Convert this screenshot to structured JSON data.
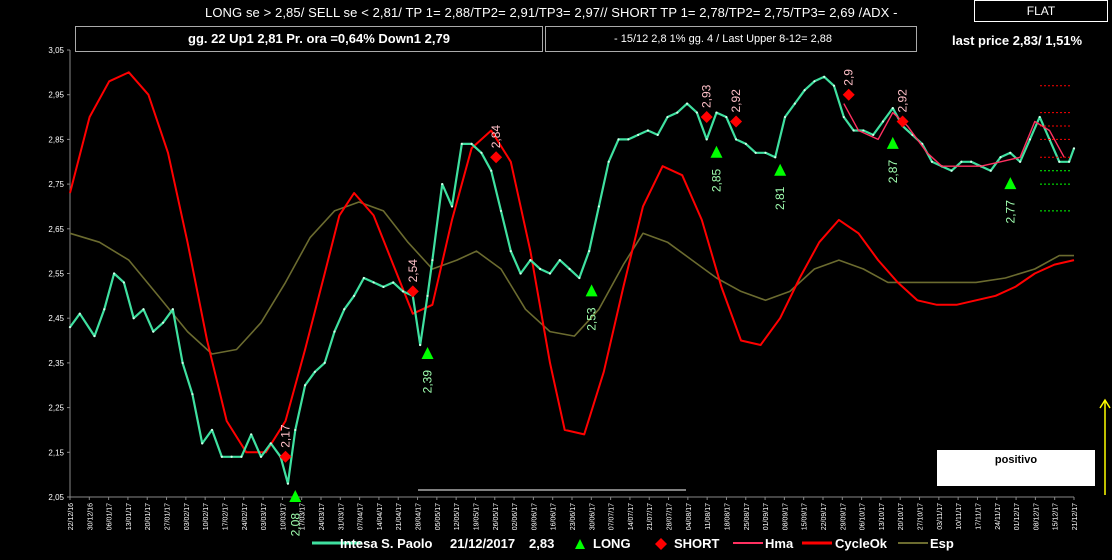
{
  "header": {
    "signal_line": "LONG se > 2,85/   SELL se < 2,81/  TP 1= 2,88/TP2= 2,91/TP3= 2,97//    SHORT  TP 1= 2,78/TP2= 2,75/TP3= 2,69 /ADX -",
    "flat_label": "FLAT",
    "box1_text": "gg. 22 Up1   2,81   Pr. ora =0,64%    Down1  2,79",
    "box2_text": "-  15/12   2,8   1%  gg. 4 / Last Upper 8-12= 2,88",
    "last_price_text": "last price 2,83/  1,51%",
    "positivo_label": "positivo"
  },
  "legend": {
    "series_name": "Intesa S. Paolo",
    "date": "21/12/2017",
    "price": "2,83",
    "long": "LONG",
    "short": "SHORT",
    "hma": "Hma",
    "cycle": "CycleOk",
    "esp": "Esp"
  },
  "colors": {
    "background": "#000000",
    "price_line": "#3fe0a0",
    "long_marker": "#00ff00",
    "short_marker": "#ff0000",
    "hma": "#ff3060",
    "cycle": "#ff0000",
    "esp": "#6b6b2f",
    "label_long": "#a0ffb0",
    "label_short": "#ffc0c8",
    "arrow": "#ffff00"
  },
  "chart_data": {
    "type": "line",
    "ylim": [
      2.05,
      3.05
    ],
    "y_ticks": [
      "3,05",
      "2,95",
      "2,85",
      "2,75",
      "2,65",
      "2,55",
      "2,45",
      "2,35",
      "2,25",
      "2,15",
      "2,05"
    ],
    "x_ticks": [
      "22/12/16",
      "30/12/16",
      "06/01/17",
      "13/01/17",
      "20/01/17",
      "27/01/17",
      "03/02/17",
      "10/02/17",
      "17/02/17",
      "24/02/17",
      "03/03/17",
      "10/03/17",
      "17/03/17",
      "24/03/17",
      "31/03/17",
      "07/04/17",
      "14/04/17",
      "21/04/17",
      "28/04/17",
      "05/05/17",
      "12/05/17",
      "19/05/17",
      "26/05/17",
      "02/06/17",
      "09/06/17",
      "16/06/17",
      "23/06/17",
      "30/06/17",
      "07/07/17",
      "14/07/17",
      "21/07/17",
      "28/07/17",
      "04/08/17",
      "11/08/17",
      "18/08/17",
      "25/08/17",
      "01/09/17",
      "08/09/17",
      "15/09/17",
      "22/09/17",
      "29/09/17",
      "06/10/17",
      "13/10/17",
      "20/10/17",
      "27/10/17",
      "03/11/17",
      "10/11/17",
      "17/11/17",
      "24/11/17",
      "01/12/17",
      "08/12/17",
      "15/12/17",
      "21/12/17"
    ],
    "n_points": 260,
    "series": [
      {
        "name": "Intesa S. Paolo",
        "points": [
          [
            0,
            2.43
          ],
          [
            4,
            2.46
          ],
          [
            10,
            2.41
          ],
          [
            14,
            2.47
          ],
          [
            18,
            2.55
          ],
          [
            22,
            2.53
          ],
          [
            26,
            2.45
          ],
          [
            30,
            2.47
          ],
          [
            34,
            2.42
          ],
          [
            38,
            2.44
          ],
          [
            42,
            2.47
          ],
          [
            46,
            2.35
          ],
          [
            50,
            2.28
          ],
          [
            54,
            2.17
          ],
          [
            58,
            2.2
          ],
          [
            62,
            2.14
          ],
          [
            66,
            2.14
          ],
          [
            70,
            2.14
          ],
          [
            74,
            2.19
          ],
          [
            78,
            2.14
          ],
          [
            82,
            2.17
          ],
          [
            86,
            2.14
          ],
          [
            89,
            2.08
          ],
          [
            92,
            2.2
          ],
          [
            96,
            2.3
          ],
          [
            100,
            2.33
          ],
          [
            104,
            2.35
          ],
          [
            108,
            2.42
          ],
          [
            112,
            2.47
          ],
          [
            116,
            2.5
          ],
          [
            120,
            2.54
          ],
          [
            124,
            2.53
          ],
          [
            128,
            2.52
          ],
          [
            132,
            2.53
          ],
          [
            136,
            2.51
          ],
          [
            140,
            2.5
          ],
          [
            143,
            2.39
          ],
          [
            146,
            2.5
          ],
          [
            148,
            2.58
          ],
          [
            152,
            2.75
          ],
          [
            156,
            2.7
          ],
          [
            160,
            2.84
          ],
          [
            164,
            2.84
          ],
          [
            168,
            2.82
          ],
          [
            172,
            2.78
          ],
          [
            176,
            2.69
          ],
          [
            180,
            2.6
          ],
          [
            184,
            2.55
          ],
          [
            188,
            2.58
          ],
          [
            192,
            2.56
          ],
          [
            196,
            2.55
          ],
          [
            200,
            2.58
          ],
          [
            204,
            2.56
          ],
          [
            208,
            2.54
          ],
          [
            212,
            2.6
          ],
          [
            216,
            2.7
          ],
          [
            220,
            2.8
          ],
          [
            224,
            2.85
          ],
          [
            228,
            2.85
          ],
          [
            232,
            2.86
          ],
          [
            236,
            2.87
          ],
          [
            240,
            2.86
          ],
          [
            244,
            2.9
          ],
          [
            248,
            2.91
          ],
          [
            252,
            2.93
          ],
          [
            256,
            2.91
          ],
          [
            260,
            2.85
          ],
          [
            264,
            2.91
          ],
          [
            268,
            2.9
          ],
          [
            272,
            2.85
          ],
          [
            276,
            2.84
          ],
          [
            280,
            2.82
          ],
          [
            284,
            2.82
          ],
          [
            288,
            2.81
          ],
          [
            292,
            2.9
          ],
          [
            296,
            2.93
          ],
          [
            300,
            2.96
          ],
          [
            304,
            2.98
          ],
          [
            308,
            2.99
          ],
          [
            312,
            2.97
          ],
          [
            316,
            2.9
          ],
          [
            320,
            2.87
          ],
          [
            324,
            2.87
          ],
          [
            328,
            2.86
          ],
          [
            332,
            2.89
          ],
          [
            336,
            2.92
          ],
          [
            340,
            2.88
          ],
          [
            344,
            2.86
          ],
          [
            348,
            2.84
          ],
          [
            352,
            2.8
          ],
          [
            356,
            2.79
          ],
          [
            360,
            2.78
          ],
          [
            364,
            2.8
          ],
          [
            368,
            2.8
          ],
          [
            372,
            2.79
          ],
          [
            376,
            2.78
          ],
          [
            380,
            2.81
          ],
          [
            384,
            2.82
          ],
          [
            388,
            2.8
          ],
          [
            392,
            2.85
          ],
          [
            396,
            2.9
          ],
          [
            400,
            2.85
          ],
          [
            404,
            2.8
          ],
          [
            408,
            2.8
          ],
          [
            410,
            2.83
          ]
        ]
      },
      {
        "name": "Hma",
        "points": [
          [
            316,
            2.93
          ],
          [
            322,
            2.87
          ],
          [
            330,
            2.85
          ],
          [
            336,
            2.91
          ],
          [
            342,
            2.88
          ],
          [
            350,
            2.82
          ],
          [
            356,
            2.79
          ],
          [
            364,
            2.79
          ],
          [
            372,
            2.79
          ],
          [
            380,
            2.8
          ],
          [
            388,
            2.81
          ],
          [
            394,
            2.89
          ],
          [
            400,
            2.87
          ],
          [
            406,
            2.81
          ]
        ]
      },
      {
        "name": "CycleOk",
        "points": [
          [
            0,
            2.73
          ],
          [
            8,
            2.9
          ],
          [
            16,
            2.98
          ],
          [
            24,
            3.0
          ],
          [
            32,
            2.95
          ],
          [
            40,
            2.82
          ],
          [
            48,
            2.62
          ],
          [
            56,
            2.4
          ],
          [
            64,
            2.22
          ],
          [
            72,
            2.15
          ],
          [
            80,
            2.15
          ],
          [
            88,
            2.22
          ],
          [
            96,
            2.38
          ],
          [
            104,
            2.55
          ],
          [
            110,
            2.68
          ],
          [
            116,
            2.73
          ],
          [
            124,
            2.68
          ],
          [
            132,
            2.57
          ],
          [
            140,
            2.46
          ],
          [
            148,
            2.48
          ],
          [
            156,
            2.67
          ],
          [
            164,
            2.83
          ],
          [
            172,
            2.87
          ],
          [
            180,
            2.8
          ],
          [
            188,
            2.6
          ],
          [
            196,
            2.35
          ],
          [
            202,
            2.2
          ],
          [
            210,
            2.19
          ],
          [
            218,
            2.33
          ],
          [
            226,
            2.52
          ],
          [
            234,
            2.7
          ],
          [
            242,
            2.79
          ],
          [
            250,
            2.77
          ],
          [
            258,
            2.67
          ],
          [
            266,
            2.52
          ],
          [
            274,
            2.4
          ],
          [
            282,
            2.39
          ],
          [
            290,
            2.45
          ],
          [
            298,
            2.54
          ],
          [
            306,
            2.62
          ],
          [
            314,
            2.67
          ],
          [
            322,
            2.64
          ],
          [
            330,
            2.58
          ],
          [
            338,
            2.53
          ],
          [
            346,
            2.49
          ],
          [
            354,
            2.48
          ],
          [
            362,
            2.48
          ],
          [
            370,
            2.49
          ],
          [
            378,
            2.5
          ],
          [
            386,
            2.52
          ],
          [
            394,
            2.55
          ],
          [
            402,
            2.57
          ],
          [
            410,
            2.58
          ]
        ]
      },
      {
        "name": "Esp",
        "points": [
          [
            0,
            2.64
          ],
          [
            12,
            2.62
          ],
          [
            24,
            2.58
          ],
          [
            36,
            2.5
          ],
          [
            48,
            2.42
          ],
          [
            58,
            2.37
          ],
          [
            68,
            2.38
          ],
          [
            78,
            2.44
          ],
          [
            88,
            2.53
          ],
          [
            98,
            2.63
          ],
          [
            108,
            2.69
          ],
          [
            118,
            2.71
          ],
          [
            128,
            2.69
          ],
          [
            138,
            2.62
          ],
          [
            148,
            2.56
          ],
          [
            158,
            2.58
          ],
          [
            166,
            2.6
          ],
          [
            176,
            2.56
          ],
          [
            186,
            2.47
          ],
          [
            196,
            2.42
          ],
          [
            206,
            2.41
          ],
          [
            216,
            2.47
          ],
          [
            226,
            2.57
          ],
          [
            234,
            2.64
          ],
          [
            244,
            2.62
          ],
          [
            254,
            2.58
          ],
          [
            264,
            2.54
          ],
          [
            274,
            2.51
          ],
          [
            284,
            2.49
          ],
          [
            294,
            2.51
          ],
          [
            304,
            2.56
          ],
          [
            314,
            2.58
          ],
          [
            324,
            2.56
          ],
          [
            334,
            2.53
          ],
          [
            346,
            2.53
          ],
          [
            358,
            2.53
          ],
          [
            370,
            2.53
          ],
          [
            382,
            2.54
          ],
          [
            394,
            2.56
          ],
          [
            404,
            2.59
          ],
          [
            410,
            2.59
          ]
        ]
      }
    ],
    "long_signals": [
      {
        "x": 92,
        "y": 2.05,
        "label": "2,08"
      },
      {
        "x": 146,
        "y": 2.37,
        "label": "2,39"
      },
      {
        "x": 213,
        "y": 2.51,
        "label": "2,53"
      },
      {
        "x": 264,
        "y": 2.82,
        "label": "2,85"
      },
      {
        "x": 290,
        "y": 2.78,
        "label": "2,81"
      },
      {
        "x": 336,
        "y": 2.84,
        "label": "2,87"
      },
      {
        "x": 384,
        "y": 2.75,
        "label": "2,77"
      }
    ],
    "short_signals": [
      {
        "x": 88,
        "y": 2.14,
        "label": "2,17"
      },
      {
        "x": 140,
        "y": 2.51,
        "label": "2,54"
      },
      {
        "x": 174,
        "y": 2.81,
        "label": "2,84"
      },
      {
        "x": 260,
        "y": 2.9,
        "label": "2,93"
      },
      {
        "x": 272,
        "y": 2.89,
        "label": "2,92"
      },
      {
        "x": 318,
        "y": 2.95,
        "label": "2,9"
      },
      {
        "x": 340,
        "y": 2.89,
        "label": "2,92"
      }
    ]
  }
}
